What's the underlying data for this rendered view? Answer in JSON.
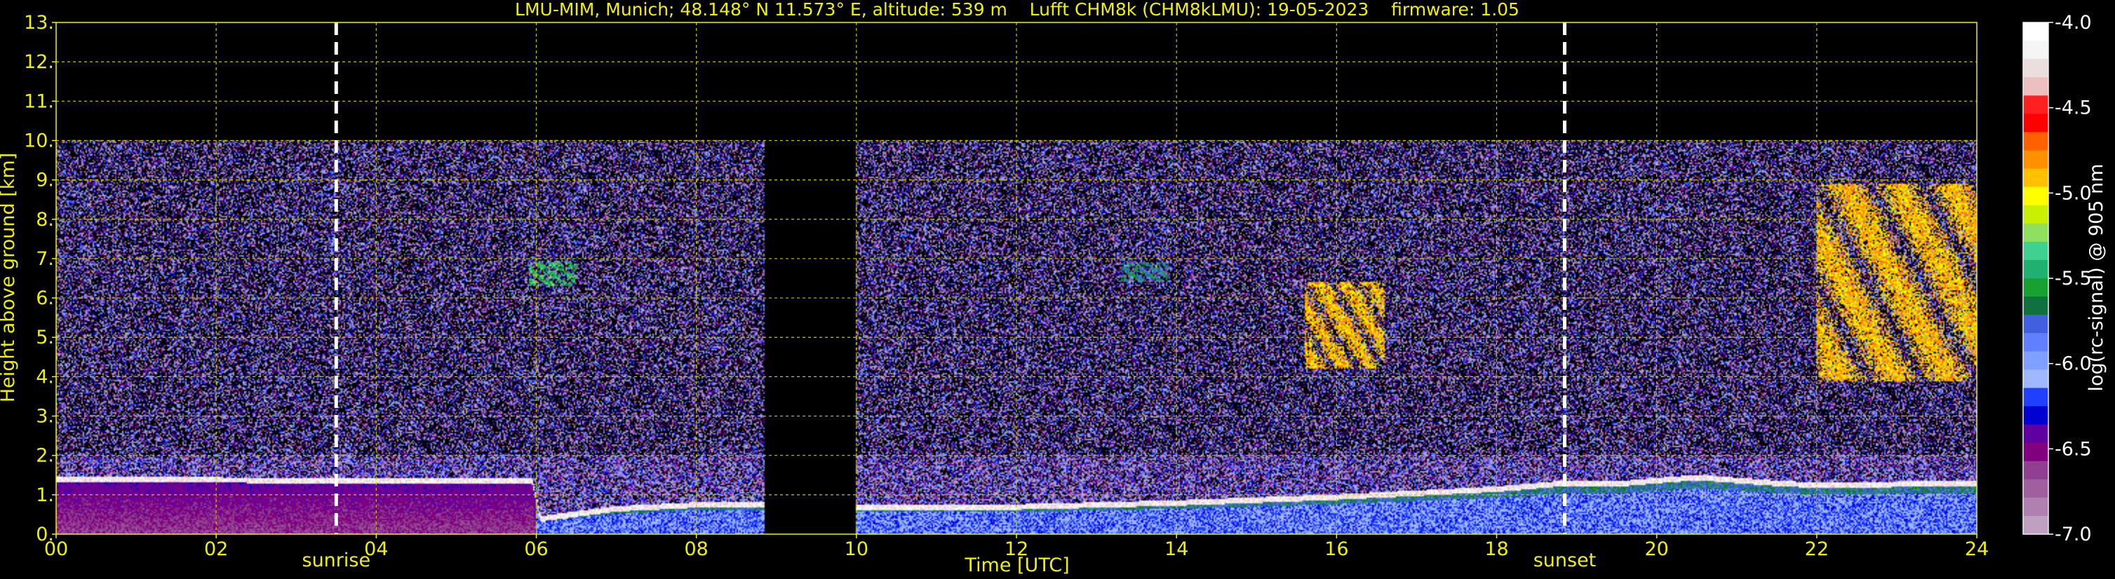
{
  "chart_data": {
    "type": "heatmap",
    "title": "LMU-MIM, Munich; 48.148° N 11.573° E, altitude: 539 m    Lufft CHM8k (CHM8kLMU): 19-05-2023    firmware: 1.05",
    "xlabel": "Time [UTC]",
    "ylabel": "Height above ground [km]",
    "xlim": [
      0,
      24
    ],
    "ylim": [
      0,
      13
    ],
    "x_ticks": [
      "00",
      "02",
      "04",
      "06",
      "08",
      "10",
      "12",
      "14",
      "16",
      "18",
      "20",
      "22",
      "24"
    ],
    "y_ticks": [
      "0.",
      "1.",
      "2.",
      "3.",
      "4.",
      "5.",
      "6.",
      "7.",
      "8.",
      "9.",
      "10.",
      "11.",
      "12.",
      "13."
    ],
    "grid": true,
    "grid_color": "#c8c800",
    "text_color": "#f0f000",
    "colorbar": {
      "label": "log(rc-signal) @ 905 nm",
      "range": [
        -7.0,
        -4.0
      ],
      "ticks": [
        "-4.0",
        "-4.5",
        "-5.0",
        "-5.5",
        "-6.0",
        "-6.5",
        "-7.0"
      ],
      "colors": [
        "#ffffff",
        "#f5f5f5",
        "#ebdede",
        "#ecc0c0",
        "#ff2020",
        "#ff0000",
        "#ff6000",
        "#ff9000",
        "#ffc000",
        "#ffff00",
        "#c8f000",
        "#90e060",
        "#40d090",
        "#20b070",
        "#18a030",
        "#107040",
        "#4060e0",
        "#6080ff",
        "#80a0ff",
        "#a0b8ff",
        "#2040ff",
        "#0000d0",
        "#6000a0",
        "#800080",
        "#904090",
        "#a060a0",
        "#b080b0",
        "#c0a0c0"
      ]
    },
    "markers": [
      {
        "label": "sunrise",
        "x": 3.5
      },
      {
        "label": "sunset",
        "x": 18.85
      }
    ],
    "data_gaps": [
      [
        8.85,
        10.0
      ]
    ],
    "max_signal_height_km": 10.0,
    "boundary_layer_top_km": [
      {
        "x": 0,
        "y": 1.4
      },
      {
        "x": 5.95,
        "y": 1.35
      },
      {
        "x": 6.05,
        "y": 0.4
      },
      {
        "x": 7.0,
        "y": 0.65
      },
      {
        "x": 8.0,
        "y": 0.75
      },
      {
        "x": 8.85,
        "y": 0.75
      },
      {
        "x": 10.0,
        "y": 0.7
      },
      {
        "x": 12.0,
        "y": 0.7
      },
      {
        "x": 14.0,
        "y": 0.8
      },
      {
        "x": 16.0,
        "y": 0.95
      },
      {
        "x": 17.0,
        "y": 1.05
      },
      {
        "x": 18.0,
        "y": 1.15
      },
      {
        "x": 18.85,
        "y": 1.3
      },
      {
        "x": 19.0,
        "y": 1.3
      },
      {
        "x": 19.6,
        "y": 1.3
      },
      {
        "x": 20.5,
        "y": 1.45
      },
      {
        "x": 21.5,
        "y": 1.3
      },
      {
        "x": 22.0,
        "y": 1.25
      },
      {
        "x": 24.0,
        "y": 1.3
      }
    ],
    "cloud_features": [
      {
        "x": [
          22.0,
          24.0
        ],
        "y": [
          3.9,
          8.9
        ],
        "level": "high"
      },
      {
        "x": [
          15.6,
          16.6
        ],
        "y": [
          4.2,
          6.4
        ],
        "level": "high"
      },
      {
        "x": [
          5.9,
          6.5
        ],
        "y": [
          6.3,
          6.9
        ],
        "level": "medium"
      },
      {
        "x": [
          13.3,
          13.9
        ],
        "y": [
          6.4,
          6.9
        ],
        "level": "low"
      }
    ]
  }
}
